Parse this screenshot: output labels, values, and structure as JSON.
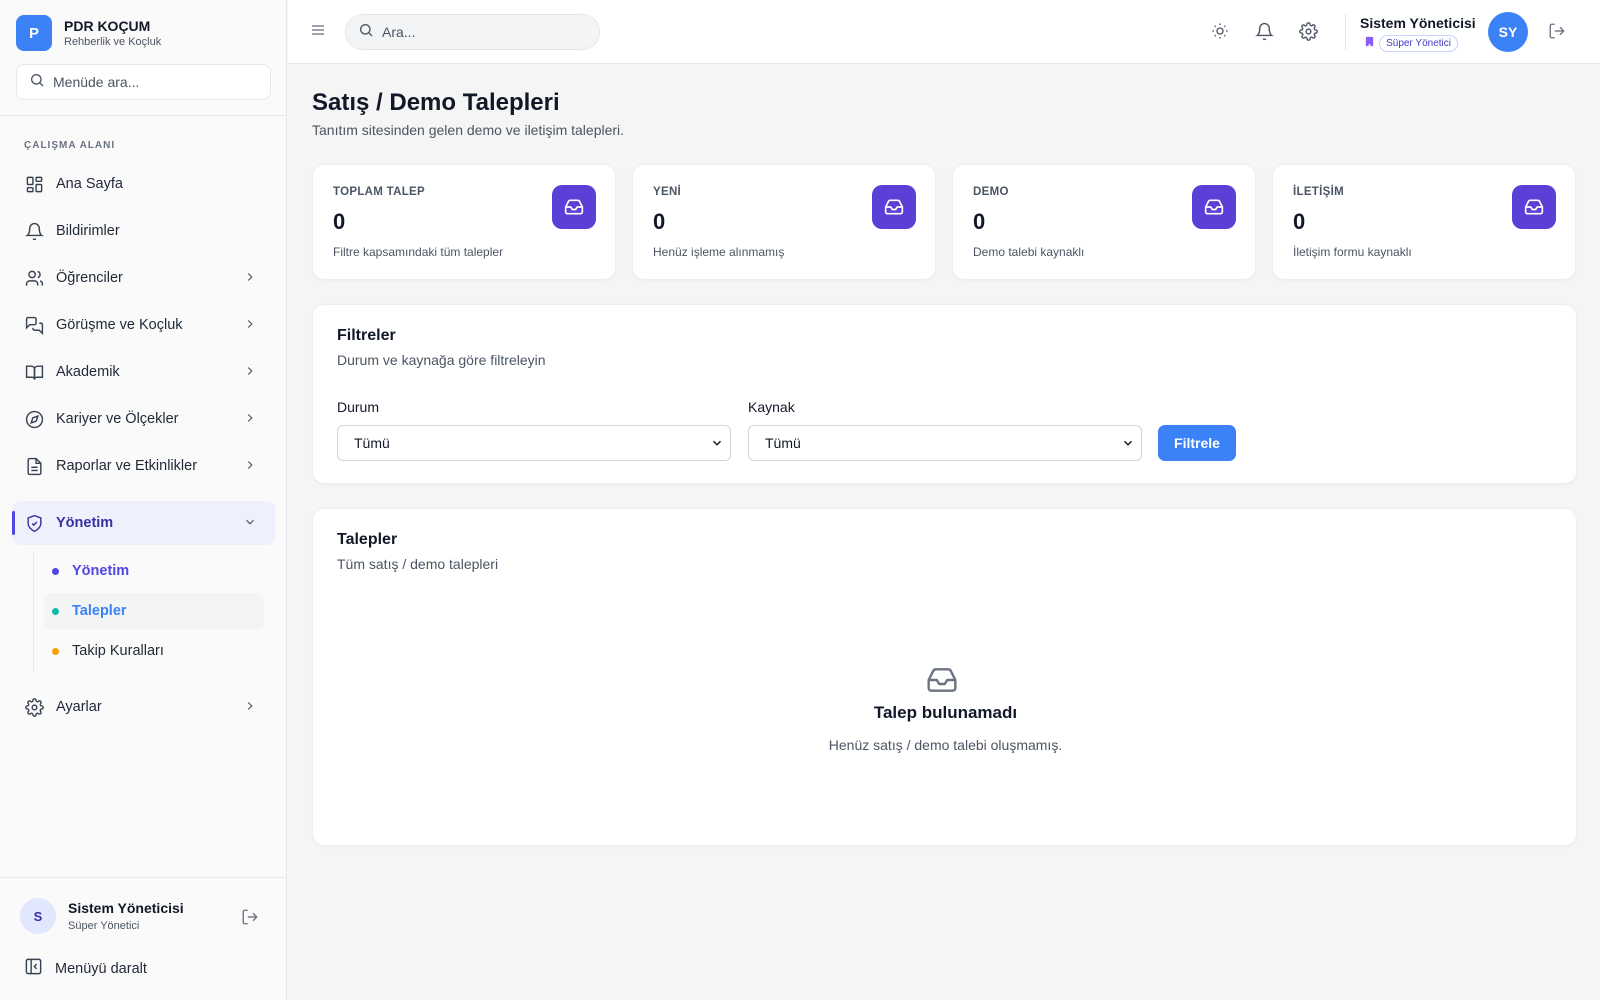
{
  "brand": {
    "logo_letter": "P",
    "name": "PDR KOÇUM",
    "subtitle": "Rehberlik ve Koçluk",
    "color": "#3b82f6"
  },
  "sidebar": {
    "search_placeholder": "Menüde ara...",
    "section_label": "ÇALIŞMA ALANI",
    "items": [
      {
        "label": "Ana Sayfa",
        "icon": "grid-icon"
      },
      {
        "label": "Bildirimler",
        "icon": "bell-icon"
      },
      {
        "label": "Öğrenciler",
        "icon": "users-icon",
        "chevron": true
      },
      {
        "label": "Görüşme ve Koçluk",
        "icon": "chat-icon",
        "chevron": true
      },
      {
        "label": "Akademik",
        "icon": "book-icon",
        "chevron": true
      },
      {
        "label": "Kariyer ve Ölçekler",
        "icon": "compass-icon",
        "chevron": true
      },
      {
        "label": "Raporlar ve Etkinlikler",
        "icon": "document-icon",
        "chevron": true
      },
      {
        "label": "Yönetim",
        "icon": "shield-icon",
        "expanded": true,
        "active": true
      },
      {
        "label": "Ayarlar",
        "icon": "gear-icon",
        "chevron": true
      }
    ],
    "sub_items": [
      {
        "label": "Yönetim",
        "dot_color": "#4f46e5",
        "text_color": "#4f46e5"
      },
      {
        "label": "Talepler",
        "dot_color": "#14b8a6",
        "text_color": "#3b82f6"
      },
      {
        "label": "Takip Kuralları",
        "dot_color": "#f59e0b",
        "text_color": "#1f2937"
      }
    ],
    "footer": {
      "avatar_letter": "S",
      "user_name": "Sistem Yöneticisi",
      "user_role": "Süper Yönetici",
      "collapse_label": "Menüyü daralt"
    }
  },
  "header": {
    "search_placeholder": "Ara...",
    "user_name": "Sistem Yöneticisi",
    "role_badge": "Süper Yönetici",
    "avatar_initials": "SY"
  },
  "page": {
    "title": "Satış / Demo Talepleri",
    "subtitle": "Tanıtım sitesinden gelen demo ve iletişim talepleri."
  },
  "stats": [
    {
      "label": "TOPLAM TALEP",
      "value": "0",
      "desc": "Filtre kapsamındaki tüm talepler"
    },
    {
      "label": "YENİ",
      "value": "0",
      "desc": "Henüz işleme alınmamış"
    },
    {
      "label": "DEMO",
      "value": "0",
      "desc": "Demo talebi kaynaklı"
    },
    {
      "label": "İLETİŞİM",
      "value": "0",
      "desc": "İletişim formu kaynaklı"
    }
  ],
  "filters": {
    "title": "Filtreler",
    "subtitle": "Durum ve kaynağa göre filtreleyin",
    "status_label": "Durum",
    "status_value": "Tümü",
    "source_label": "Kaynak",
    "source_value": "Tümü",
    "button_label": "Filtrele"
  },
  "requests": {
    "title": "Talepler",
    "subtitle": "Tüm satış / demo talepleri",
    "empty_title": "Talep bulunamadı",
    "empty_subtitle": "Henüz satış / demo talebi oluşmamış."
  },
  "colors": {
    "accent": "#4f46e5",
    "stat_icon_bg": "#5b3fd6",
    "primary_button": "#3b82f6"
  }
}
